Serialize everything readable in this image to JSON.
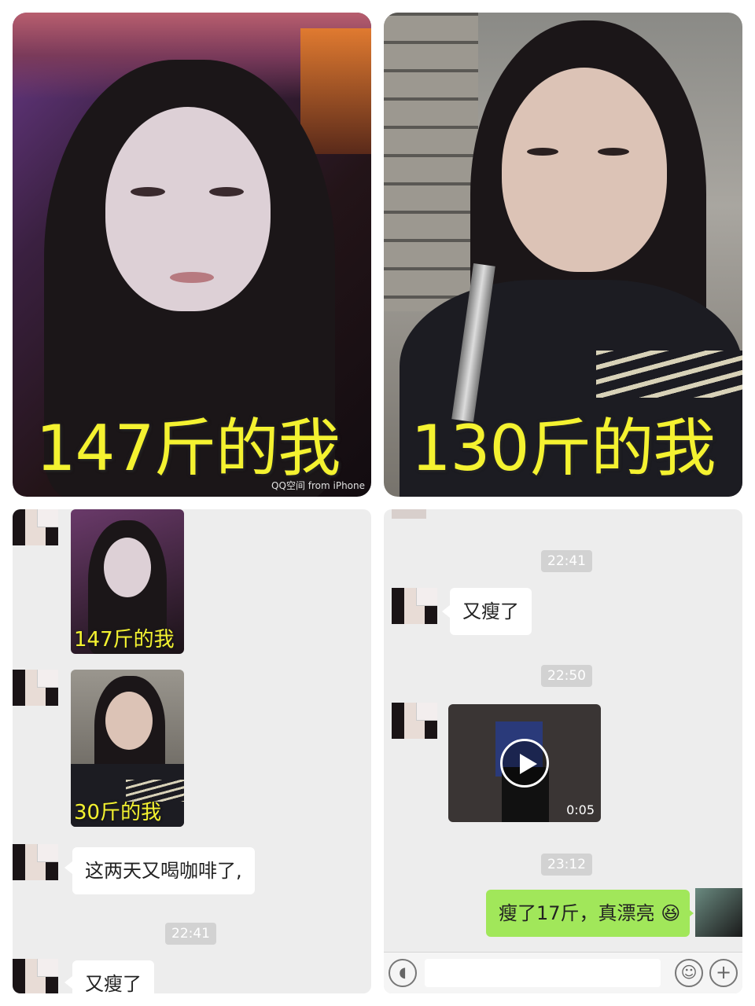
{
  "top_left_photo": {
    "caption": "147斤的我",
    "watermark": "QQ空间 from iPhone"
  },
  "top_right_photo": {
    "caption": "130斤的我"
  },
  "left_chat": {
    "thumb1_caption": "147斤的我",
    "thumb2_caption": "30斤的我",
    "message1": "这两天又喝咖啡了,",
    "time1": "22:41",
    "message2": "又瘦了"
  },
  "right_chat": {
    "time1": "22:41",
    "message1": "又瘦了",
    "time2": "22:50",
    "video_duration": "0:05",
    "time3": "23:12",
    "reply": "瘦了17斤，真漂亮",
    "emoji": "😆"
  },
  "colors": {
    "caption_yellow": "#f4f230",
    "bubble_green": "#a1e75a",
    "chat_bg": "#ededed"
  },
  "icons": [
    "play-icon",
    "voice-icon",
    "emoji-icon",
    "plus-icon"
  ]
}
